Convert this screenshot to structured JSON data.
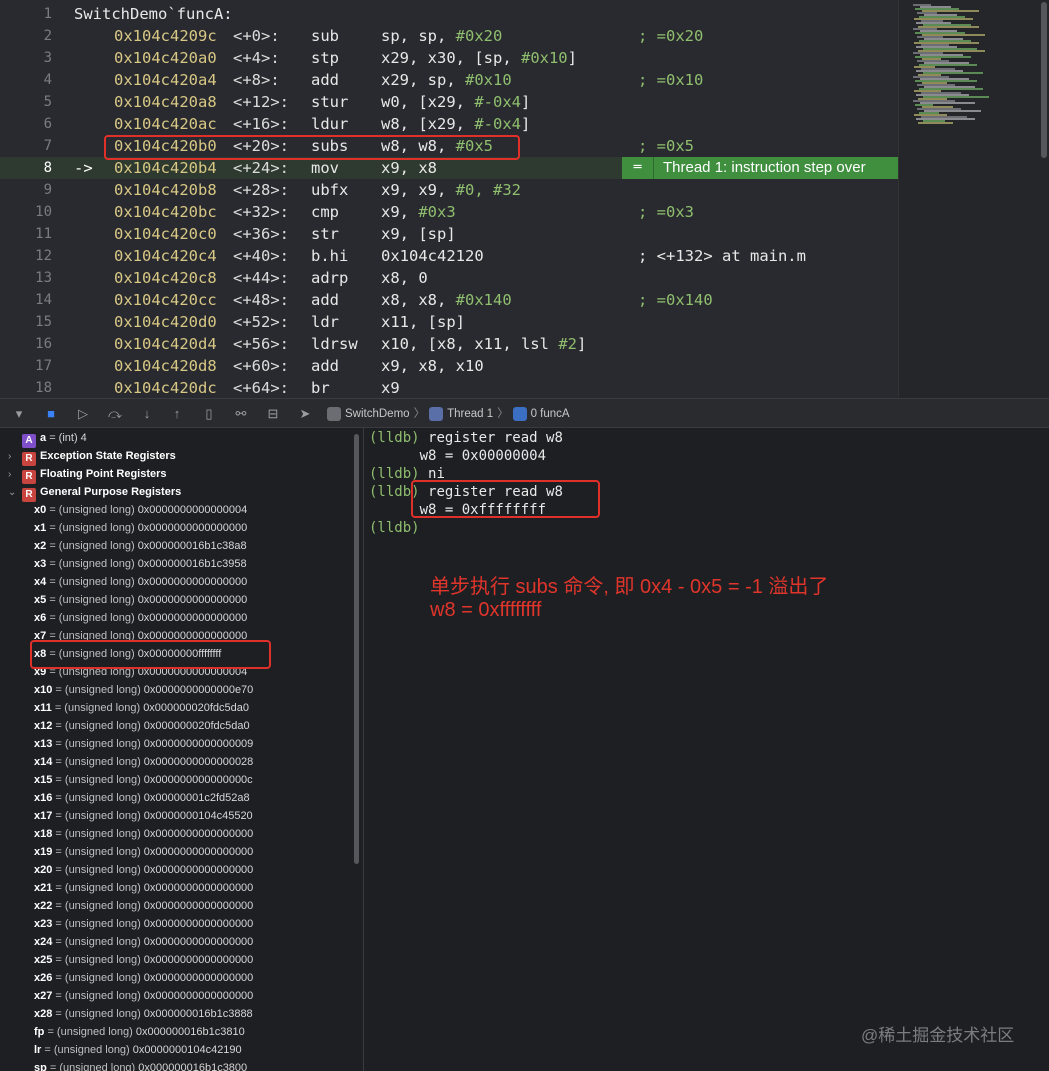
{
  "editor": {
    "header": "SwitchDemo`funcA:",
    "current_line": 8,
    "step_badge": "Thread 1: instruction step over",
    "lines": [
      {
        "n": 2,
        "addr": "0x104c4209c",
        "off": "<+0>:",
        "mn": "sub",
        "ops": [
          [
            "sp, sp, ",
            "t"
          ],
          [
            "#0x20",
            "n"
          ]
        ],
        "cmt": "; =0x20"
      },
      {
        "n": 3,
        "addr": "0x104c420a0",
        "off": "<+4>:",
        "mn": "stp",
        "ops": [
          [
            "x29, x30, [sp, ",
            "t"
          ],
          [
            "#0x10",
            "n"
          ],
          [
            "]",
            "t"
          ]
        ],
        "cmt": ""
      },
      {
        "n": 4,
        "addr": "0x104c420a4",
        "off": "<+8>:",
        "mn": "add",
        "ops": [
          [
            "x29, sp, ",
            "t"
          ],
          [
            "#0x10",
            "n"
          ]
        ],
        "cmt": "; =0x10"
      },
      {
        "n": 5,
        "addr": "0x104c420a8",
        "off": "<+12>:",
        "mn": "stur",
        "ops": [
          [
            "w0, [x29, ",
            "t"
          ],
          [
            "#-0x4",
            "n"
          ],
          [
            "]",
            "t"
          ]
        ],
        "cmt": ""
      },
      {
        "n": 6,
        "addr": "0x104c420ac",
        "off": "<+16>:",
        "mn": "ldur",
        "ops": [
          [
            "w8, [x29, ",
            "t"
          ],
          [
            "#-0x4",
            "n"
          ],
          [
            "]",
            "t"
          ]
        ],
        "cmt": ""
      },
      {
        "n": 7,
        "addr": "0x104c420b0",
        "off": "<+20>:",
        "mn": "subs",
        "ops": [
          [
            "w8, w8, ",
            "t"
          ],
          [
            "#0x5",
            "n"
          ]
        ],
        "cmt": "; =0x5"
      },
      {
        "n": 8,
        "addr": "0x104c420b4",
        "off": "<+24>:",
        "mn": "mov",
        "ops": [
          [
            "x9, x8",
            "t"
          ]
        ],
        "cmt": "",
        "arrow": "->"
      },
      {
        "n": 9,
        "addr": "0x104c420b8",
        "off": "<+28>:",
        "mn": "ubfx",
        "ops": [
          [
            "x9, x9, ",
            "t"
          ],
          [
            "#0, #32",
            "n"
          ]
        ],
        "cmt": ""
      },
      {
        "n": 10,
        "addr": "0x104c420bc",
        "off": "<+32>:",
        "mn": "cmp",
        "ops": [
          [
            "x9, ",
            "t"
          ],
          [
            "#0x3",
            "n"
          ]
        ],
        "cmt": "; =0x3"
      },
      {
        "n": 11,
        "addr": "0x104c420c0",
        "off": "<+36>:",
        "mn": "str",
        "ops": [
          [
            "x9, [sp]",
            "t"
          ]
        ],
        "cmt": ""
      },
      {
        "n": 12,
        "addr": "0x104c420c4",
        "off": "<+40>:",
        "mn": "b.hi",
        "ops": [
          [
            "0x104c42120",
            "t"
          ]
        ],
        "cmt": "; <+132> at main.m",
        "cmt_plain": true
      },
      {
        "n": 13,
        "addr": "0x104c420c8",
        "off": "<+44>:",
        "mn": "adrp",
        "ops": [
          [
            "x8, 0",
            "t"
          ]
        ],
        "cmt": ""
      },
      {
        "n": 14,
        "addr": "0x104c420cc",
        "off": "<+48>:",
        "mn": "add",
        "ops": [
          [
            "x8, x8, ",
            "t"
          ],
          [
            "#0x140",
            "n"
          ]
        ],
        "cmt": "; =0x140"
      },
      {
        "n": 15,
        "addr": "0x104c420d0",
        "off": "<+52>:",
        "mn": "ldr",
        "ops": [
          [
            "x11, [sp]",
            "t"
          ]
        ],
        "cmt": ""
      },
      {
        "n": 16,
        "addr": "0x104c420d4",
        "off": "<+56>:",
        "mn": "ldrsw",
        "ops": [
          [
            "x10, [x8, x11, lsl ",
            "t"
          ],
          [
            "#2",
            "n"
          ],
          [
            "]",
            "t"
          ]
        ],
        "cmt": ""
      },
      {
        "n": 17,
        "addr": "0x104c420d8",
        "off": "<+60>:",
        "mn": "add",
        "ops": [
          [
            "x9, x8, x10",
            "t"
          ]
        ],
        "cmt": ""
      },
      {
        "n": 18,
        "addr": "0x104c420dc",
        "off": "<+64>:",
        "mn": "br",
        "ops": [
          [
            "x9",
            "t"
          ]
        ],
        "cmt": ""
      }
    ]
  },
  "debugbar": {
    "crumbs": [
      "SwitchDemo",
      "Thread 1",
      "0 funcA"
    ]
  },
  "variables": {
    "local": {
      "name": "a",
      "value": "= (int) 4"
    },
    "groups": [
      "Exception State Registers",
      "Floating Point Registers",
      "General Purpose Registers"
    ],
    "registers": [
      {
        "name": "x0",
        "val": "0x0000000000000004"
      },
      {
        "name": "x1",
        "val": "0x0000000000000000"
      },
      {
        "name": "x2",
        "val": "0x000000016b1c38a8"
      },
      {
        "name": "x3",
        "val": "0x000000016b1c3958"
      },
      {
        "name": "x4",
        "val": "0x0000000000000000"
      },
      {
        "name": "x5",
        "val": "0x0000000000000000"
      },
      {
        "name": "x6",
        "val": "0x0000000000000000"
      },
      {
        "name": "x7",
        "val": "0x0000000000000000"
      },
      {
        "name": "x8",
        "val": "0x00000000ffffffff"
      },
      {
        "name": "x9",
        "val": "0x0000000000000004"
      },
      {
        "name": "x10",
        "val": "0x0000000000000e70"
      },
      {
        "name": "x11",
        "val": "0x000000020fdc5da0"
      },
      {
        "name": "x12",
        "val": "0x000000020fdc5da0"
      },
      {
        "name": "x13",
        "val": "0x0000000000000009"
      },
      {
        "name": "x14",
        "val": "0x0000000000000028"
      },
      {
        "name": "x15",
        "val": "0x000000000000000c"
      },
      {
        "name": "x16",
        "val": "0x00000001c2fd52a8"
      },
      {
        "name": "x17",
        "val": "0x0000000104c45520"
      },
      {
        "name": "x18",
        "val": "0x0000000000000000"
      },
      {
        "name": "x19",
        "val": "0x0000000000000000"
      },
      {
        "name": "x20",
        "val": "0x0000000000000000"
      },
      {
        "name": "x21",
        "val": "0x0000000000000000"
      },
      {
        "name": "x22",
        "val": "0x0000000000000000"
      },
      {
        "name": "x23",
        "val": "0x0000000000000000"
      },
      {
        "name": "x24",
        "val": "0x0000000000000000"
      },
      {
        "name": "x25",
        "val": "0x0000000000000000"
      },
      {
        "name": "x26",
        "val": "0x0000000000000000"
      },
      {
        "name": "x27",
        "val": "0x0000000000000000"
      },
      {
        "name": "x28",
        "val": "0x000000016b1c3888"
      },
      {
        "name": "fp",
        "val": "0x000000016b1c3810"
      },
      {
        "name": "lr",
        "val": "0x0000000104c42190"
      },
      {
        "name": "sp",
        "val": "0x000000016b1c3800"
      }
    ],
    "reg_type": "= (unsigned long)"
  },
  "console": {
    "prompt": "(lldb)",
    "lines": [
      {
        "kind": "cmd",
        "text": "register read w8"
      },
      {
        "kind": "out",
        "text": "      w8 = 0x00000004"
      },
      {
        "kind": "cmd",
        "text": "ni"
      },
      {
        "kind": "cmd",
        "text": "register read w8"
      },
      {
        "kind": "out",
        "text": "      w8 = 0xffffffff"
      },
      {
        "kind": "cmd",
        "text": ""
      }
    ],
    "note_line1": "单步执行 subs 命令, 即 0x4 - 0x5 = -1 溢出了",
    "note_line2": "w8 = 0xffffffff",
    "watermark": "@稀土掘金技术社区"
  },
  "colors": {
    "address": "#d8c885",
    "number": "#8fbf6e",
    "annotation": "#e0302a",
    "step_badge": "#3f8f3f"
  }
}
